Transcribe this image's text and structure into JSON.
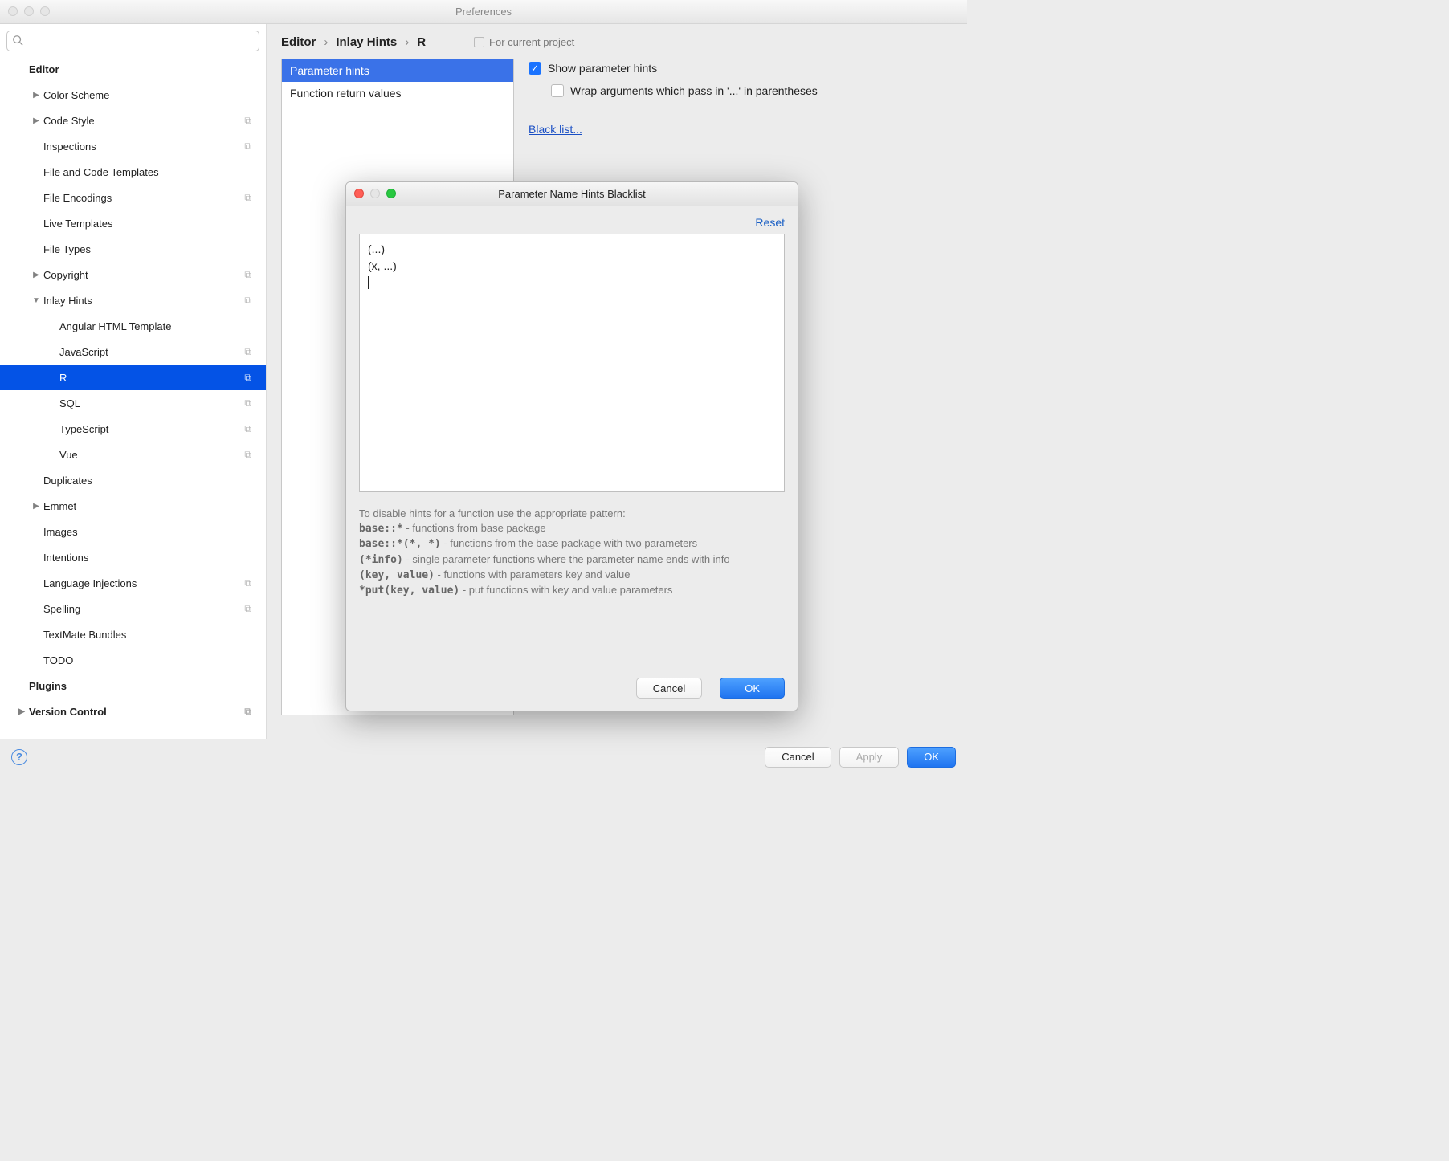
{
  "window_title": "Preferences",
  "search_placeholder": "",
  "tree": {
    "editor": "Editor",
    "color_scheme": "Color Scheme",
    "code_style": "Code Style",
    "inspections": "Inspections",
    "file_code_templates": "File and Code Templates",
    "file_encodings": "File Encodings",
    "live_templates": "Live Templates",
    "file_types": "File Types",
    "copyright": "Copyright",
    "inlay_hints": "Inlay Hints",
    "angular": "Angular HTML Template",
    "javascript": "JavaScript",
    "r": "R",
    "sql": "SQL",
    "typescript": "TypeScript",
    "vue": "Vue",
    "duplicates": "Duplicates",
    "emmet": "Emmet",
    "images": "Images",
    "intentions": "Intentions",
    "language_injections": "Language Injections",
    "spelling": "Spelling",
    "textmate": "TextMate Bundles",
    "todo": "TODO",
    "plugins": "Plugins",
    "version_control": "Version Control"
  },
  "breadcrumb": {
    "a": "Editor",
    "b": "Inlay Hints",
    "c": "R"
  },
  "project_scope": "For current project",
  "categories": {
    "param": "Parameter hints",
    "ret": "Function return values"
  },
  "opts": {
    "show_param": "Show parameter hints",
    "wrap": "Wrap arguments which pass in '...' in parentheses",
    "blacklist_link": "Black list..."
  },
  "modal": {
    "title": "Parameter Name Hints Blacklist",
    "reset": "Reset",
    "text": "(...)\n(x, ...)",
    "hint_intro": "To disable hints for a function use the appropriate pattern:",
    "h1_code": "base::*",
    "h1_txt": " - functions from base package",
    "h2_code": "base::*(*, *)",
    "h2_txt": " - functions from the base package with two parameters",
    "h3_code": "(*info)",
    "h3_txt": " - single parameter functions where the parameter name ends with info",
    "h4_code": "(key, value)",
    "h4_txt": " - functions with parameters key and value",
    "h5_code": "*put(key, value)",
    "h5_txt": " - put functions with key and value parameters",
    "cancel": "Cancel",
    "ok": "OK"
  },
  "footer": {
    "cancel": "Cancel",
    "apply": "Apply",
    "ok": "OK"
  }
}
